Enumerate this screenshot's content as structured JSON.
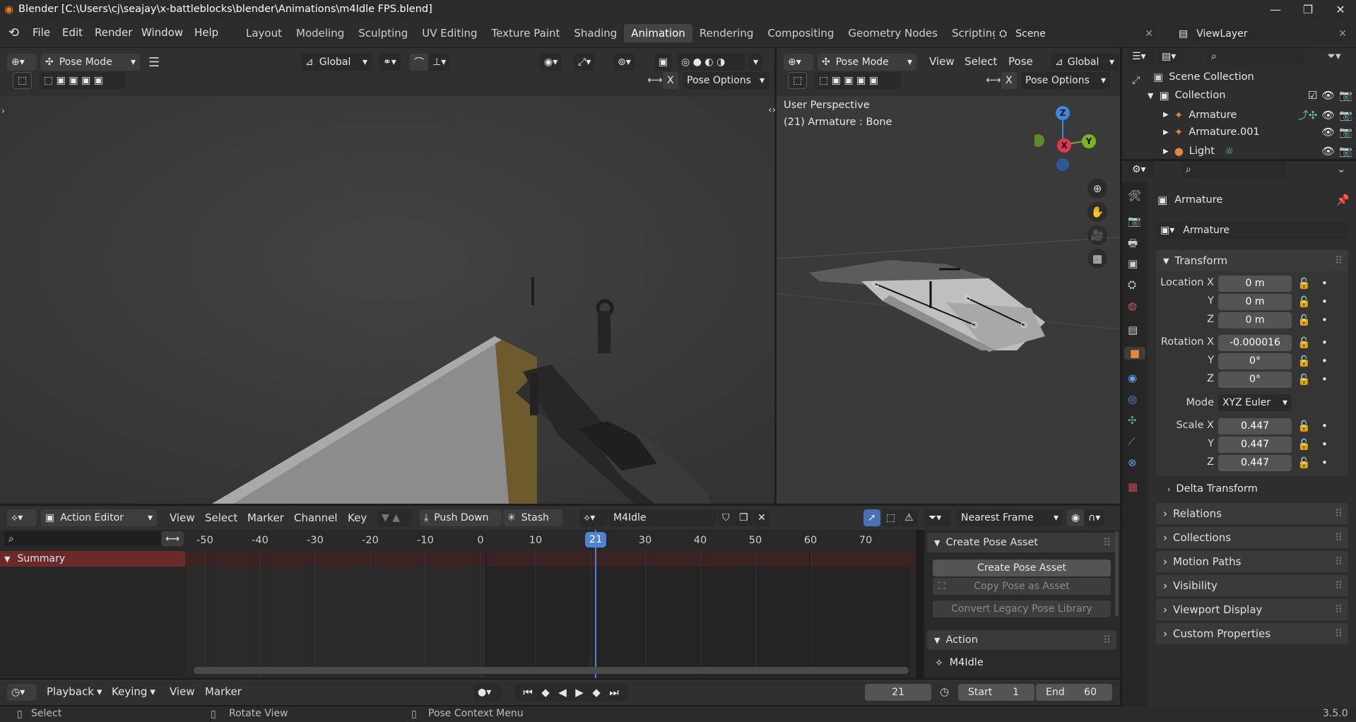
{
  "app": {
    "title": "Blender [C:\\Users\\cj\\seajay\\x-battleblocks\\blender\\Animations\\m4Idle FPS.blend]",
    "version": "3.5.0"
  },
  "menu": {
    "file": "File",
    "edit": "Edit",
    "render": "Render",
    "window": "Window",
    "help": "Help"
  },
  "workspaces": [
    "Layout",
    "Modeling",
    "Sculpting",
    "UV Editing",
    "Texture Paint",
    "Shading",
    "Animation",
    "Rendering",
    "Compositing",
    "Geometry Nodes",
    "Scripting"
  ],
  "scene": {
    "name": "Scene",
    "view_layer": "ViewLayer"
  },
  "viewport_left": {
    "mode": "Pose Mode",
    "orientation": "Global",
    "pose_options": "Pose Options",
    "x_label": "X"
  },
  "viewport_right": {
    "mode": "Pose Mode",
    "view": "View",
    "select": "Select",
    "pose": "Pose",
    "orientation": "Global",
    "pose_options": "Pose Options",
    "x_label": "X",
    "perspective": "User Perspective",
    "object_info": "(21) Armature : Bone",
    "gizmo": {
      "z": "Z",
      "y": "Y",
      "x": "X"
    }
  },
  "outliner": {
    "scene_collection": "Scene Collection",
    "collection": "Collection",
    "items": [
      {
        "name": "Armature"
      },
      {
        "name": "Armature.001"
      },
      {
        "name": "Light"
      }
    ]
  },
  "properties": {
    "object_name": "Armature",
    "data_name": "Armature",
    "transform": "Transform",
    "location_label": "Location X",
    "y": "Y",
    "z": "Z",
    "location": [
      "0 m",
      "0 m",
      "0 m"
    ],
    "rotation_label": "Rotation X",
    "rotation": [
      "-0.000016",
      "0°",
      "0°"
    ],
    "mode_label": "Mode",
    "mode": "XYZ Euler",
    "scale_label": "Scale X",
    "scale": [
      "0.447",
      "0.447",
      "0.447"
    ],
    "delta_transform": "Delta Transform",
    "sections": [
      "Relations",
      "Collections",
      "Motion Paths",
      "Visibility",
      "Viewport Display",
      "Custom Properties"
    ]
  },
  "action_editor": {
    "editor": "Action Editor",
    "view": "View",
    "select": "Select",
    "marker": "Marker",
    "channel": "Channel",
    "key": "Key",
    "push_down": "Push Down",
    "stash": "Stash",
    "action_name": "M4Idle",
    "snap": "Nearest Frame",
    "summary": "Summary",
    "ticks": [
      "-50",
      "-40",
      "-30",
      "-20",
      "-10",
      "0",
      "10",
      "21",
      "30",
      "40",
      "50",
      "60",
      "70"
    ],
    "current_frame": "21"
  },
  "pose_panel": {
    "create_pose_asset_header": "Create Pose Asset",
    "create_pose_asset": "Create Pose Asset",
    "copy_pose": "Copy Pose as Asset",
    "convert": "Convert Legacy Pose Library",
    "action_header": "Action",
    "action_name": "M4Idle"
  },
  "timeline": {
    "playback": "Playback",
    "keying": "Keying",
    "view": "View",
    "marker": "Marker",
    "frame": "21",
    "start_label": "Start",
    "start": "1",
    "end_label": "End",
    "end": "60"
  },
  "status": {
    "select": "Select",
    "rotate": "Rotate View",
    "context": "Pose Context Menu"
  },
  "colors": {
    "accent": "#4772b3",
    "active_frame": "#4f82d3",
    "summary_bg": "#6b2a2a",
    "x_axis": "#e0384f",
    "y_axis": "#79b522",
    "z_axis": "#3e86e0"
  }
}
